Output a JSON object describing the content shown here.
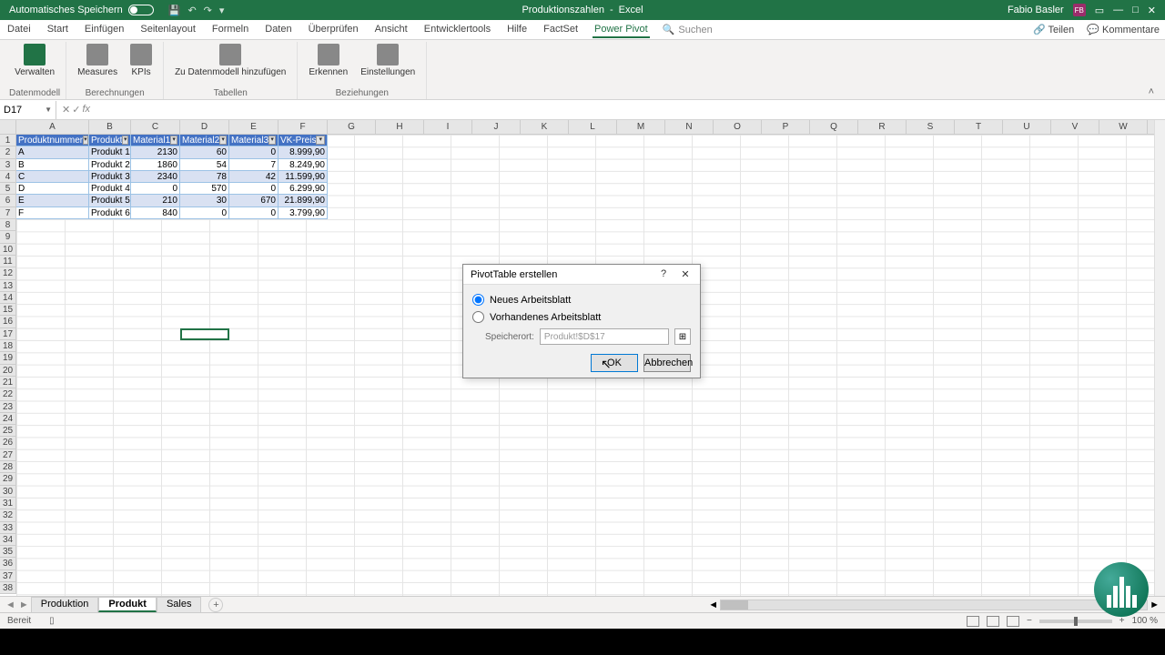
{
  "titlebar": {
    "autosave": "Automatisches Speichern",
    "doc_title": "Produktionszahlen",
    "app": "Excel",
    "user": "Fabio Basler",
    "initials": "FB"
  },
  "menu": {
    "tabs": [
      "Datei",
      "Start",
      "Einfügen",
      "Seitenlayout",
      "Formeln",
      "Daten",
      "Überprüfen",
      "Ansicht",
      "Entwicklertools",
      "Hilfe",
      "FactSet",
      "Power Pivot"
    ],
    "active": 11,
    "search": "Suchen",
    "share": "Teilen",
    "comments": "Kommentare"
  },
  "ribbon": {
    "groups": [
      {
        "label": "Datenmodell",
        "btns": [
          "Verwalten"
        ]
      },
      {
        "label": "Berechnungen",
        "btns": [
          "Measures",
          "KPIs"
        ]
      },
      {
        "label": "Tabellen",
        "btns": [
          "Zu Datenmodell hinzufügen"
        ]
      },
      {
        "label": "Beziehungen",
        "btns": [
          "Erkennen",
          "Einstellungen"
        ]
      }
    ]
  },
  "namebox": "D17",
  "columns_std": [
    "G",
    "H",
    "I",
    "J",
    "K",
    "L",
    "M",
    "N",
    "O",
    "P",
    "Q",
    "R",
    "S",
    "T",
    "U",
    "V",
    "W"
  ],
  "table": {
    "headers": [
      "Produktnummer",
      "Produkt",
      "Material1",
      "Material2",
      "Material3",
      "VK-Preis"
    ],
    "rows": [
      [
        "A",
        "Produkt 1",
        "2130",
        "60",
        "0",
        "8.999,90"
      ],
      [
        "B",
        "Produkt 2",
        "1860",
        "54",
        "7",
        "8.249,90"
      ],
      [
        "C",
        "Produkt 3",
        "2340",
        "78",
        "42",
        "11.599,90"
      ],
      [
        "D",
        "Produkt 4",
        "0",
        "570",
        "0",
        "6.299,90"
      ],
      [
        "E",
        "Produkt 5",
        "210",
        "30",
        "670",
        "21.899,90"
      ],
      [
        "F",
        "Produkt 6",
        "840",
        "0",
        "0",
        "3.799,90"
      ]
    ]
  },
  "dialog": {
    "title": "PivotTable erstellen",
    "opt_new": "Neues Arbeitsblatt",
    "opt_existing": "Vorhandenes Arbeitsblatt",
    "loc_label": "Speicherort:",
    "loc_value": "Produkt!$D$17",
    "ok": "OK",
    "cancel": "Abbrechen"
  },
  "sheets": {
    "tabs": [
      "Produktion",
      "Produkt",
      "Sales"
    ],
    "active": 1
  },
  "status": {
    "ready": "Bereit",
    "zoom": "100 %"
  },
  "row_count": 38
}
